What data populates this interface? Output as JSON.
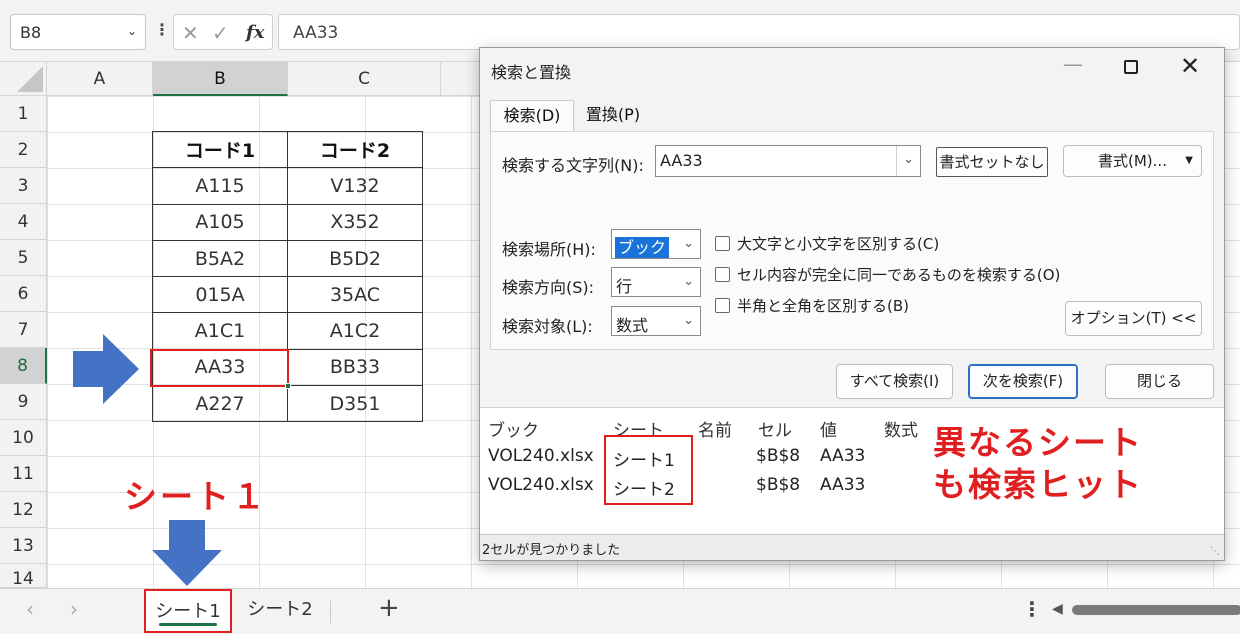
{
  "formula_bar": {
    "name_box": "B8",
    "formula_value": "AA33",
    "fx_label": "fx"
  },
  "sheet": {
    "columns": [
      "A",
      "B",
      "C"
    ],
    "selected_column": "B",
    "rows": [
      "1",
      "2",
      "3",
      "4",
      "5",
      "6",
      "7",
      "8",
      "9",
      "10",
      "11",
      "12",
      "13",
      "14"
    ],
    "selected_row": "8",
    "table": {
      "headers": [
        "コード1",
        "コード2"
      ],
      "rows": [
        [
          "A115",
          "V132"
        ],
        [
          "A105",
          "X352"
        ],
        [
          "B5A2",
          "B5D2"
        ],
        [
          "015A",
          "35AC"
        ],
        [
          "A1C1",
          "A1C2"
        ],
        [
          "AA33",
          "BB33"
        ],
        [
          "A227",
          "D351"
        ]
      ]
    }
  },
  "annotations": {
    "sheet_label": "シート１",
    "result_label_line1": "異なるシート",
    "result_label_line2": "も検索ヒット",
    "accent_color": "#e02020",
    "arrow_color": "#4472c4"
  },
  "sheet_tabs": {
    "tabs": [
      "シート1",
      "シート2"
    ],
    "active": "シート1",
    "add_label": "+"
  },
  "dialog": {
    "title": "検索と置換",
    "tabs": [
      "検索(D)",
      "置換(P)"
    ],
    "find_label": "検索する文字列(N):",
    "find_value": "AA33",
    "format_status_button": "書式セットなし",
    "format_button": "書式(M)...",
    "within_label": "検索場所(H):",
    "within_value": "ブック",
    "direction_label": "検索方向(S):",
    "direction_value": "行",
    "lookin_label": "検索対象(L):",
    "lookin_value": "数式",
    "checkboxes": [
      "大文字と小文字を区別する(C)",
      "セル内容が完全に同一であるものを検索する(O)",
      "半角と全角を区別する(B)"
    ],
    "options_button": "オプション(T) <<",
    "find_all_button": "すべて検索(I)",
    "find_next_button": "次を検索(F)",
    "close_button": "閉じる",
    "results": {
      "columns": [
        "ブック",
        "シート",
        "名前",
        "セル",
        "値",
        "数式"
      ],
      "rows": [
        {
          "book": "VOL240.xlsx",
          "sheet": "シート1",
          "name": "",
          "cell": "$B$8",
          "value": "AA33",
          "formula": ""
        },
        {
          "book": "VOL240.xlsx",
          "sheet": "シート2",
          "name": "",
          "cell": "$B$8",
          "value": "AA33",
          "formula": ""
        }
      ]
    },
    "status_text": "2セルが見つかりました"
  }
}
